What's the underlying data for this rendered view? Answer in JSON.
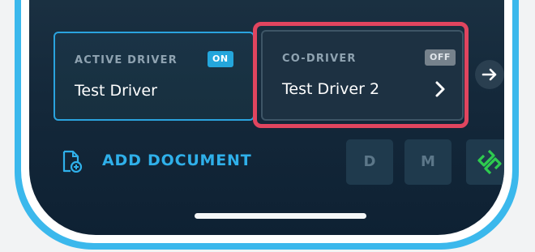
{
  "active_driver": {
    "title": "ACTIVE DRIVER",
    "status": "ON",
    "name": "Test Driver"
  },
  "co_driver": {
    "title": "CO-DRIVER",
    "status": "OFF",
    "name": "Test Driver 2"
  },
  "actions": {
    "add_document_label": "ADD DOCUMENT",
    "d_label": "D",
    "m_label": "M"
  },
  "icons": {
    "next": "arrow-right-icon",
    "chevron": "chevron-right-icon",
    "document": "document-add-icon",
    "link": "link-icon"
  },
  "colors": {
    "accent": "#2fb0ea",
    "highlight": "#e0455f",
    "link_green": "#2ecc4f"
  }
}
